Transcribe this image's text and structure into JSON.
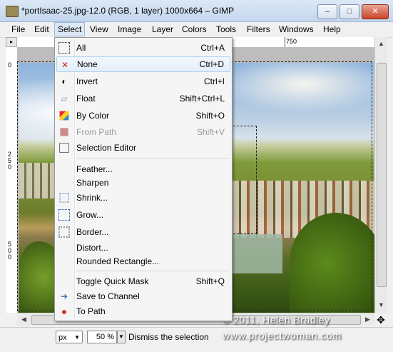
{
  "window": {
    "title": "*portIsaac-25.jpg-12.0 (RGB, 1 layer) 1000x664 – GIMP",
    "minimize": "–",
    "maximize": "□",
    "close": "✕"
  },
  "menubar": {
    "items": [
      "File",
      "Edit",
      "Select",
      "View",
      "Image",
      "Layer",
      "Colors",
      "Tools",
      "Filters",
      "Windows",
      "Help"
    ],
    "active": "Select"
  },
  "rulers": {
    "top_tick": "750",
    "left_ticks": [
      "0",
      "250",
      "500"
    ],
    "corner_icon": "▸"
  },
  "select_menu": {
    "items": [
      {
        "label": "All",
        "shortcut": "Ctrl+A",
        "icon": "select-all-icon",
        "enabled": true
      },
      {
        "label": "None",
        "shortcut": "Ctrl+D",
        "icon": "select-none-icon",
        "enabled": true,
        "highlighted": true
      },
      {
        "label": "Invert",
        "shortcut": "Ctrl+I",
        "icon": "invert-icon",
        "enabled": true
      },
      {
        "label": "Float",
        "shortcut": "Shift+Ctrl+L",
        "icon": "float-icon",
        "enabled": true
      },
      {
        "label": "By Color",
        "shortcut": "Shift+O",
        "icon": "by-color-icon",
        "enabled": true
      },
      {
        "label": "From Path",
        "shortcut": "Shift+V",
        "icon": "from-path-icon",
        "enabled": false
      },
      {
        "label": "Selection Editor",
        "shortcut": "",
        "icon": "selection-editor-icon",
        "enabled": true
      },
      {
        "label": "Feather...",
        "shortcut": "",
        "icon": "",
        "enabled": true
      },
      {
        "label": "Sharpen",
        "shortcut": "",
        "icon": "",
        "enabled": true
      },
      {
        "label": "Shrink...",
        "shortcut": "",
        "icon": "shrink-icon",
        "enabled": true
      },
      {
        "label": "Grow...",
        "shortcut": "",
        "icon": "grow-icon",
        "enabled": true
      },
      {
        "label": "Border...",
        "shortcut": "",
        "icon": "border-icon",
        "enabled": true
      },
      {
        "label": "Distort...",
        "shortcut": "",
        "icon": "",
        "enabled": true
      },
      {
        "label": "Rounded Rectangle...",
        "shortcut": "",
        "icon": "",
        "enabled": true
      },
      {
        "label": "Toggle Quick Mask",
        "shortcut": "Shift+Q",
        "icon": "",
        "enabled": true
      },
      {
        "label": "Save to Channel",
        "shortcut": "",
        "icon": "save-channel-icon",
        "enabled": true
      },
      {
        "label": "To Path",
        "shortcut": "",
        "icon": "to-path-icon",
        "enabled": true
      }
    ]
  },
  "statusbar": {
    "unit": "px",
    "zoom": "50 %",
    "message": "Dismiss the selection"
  },
  "watermark": {
    "line1": "© 2011, Helen Bradley",
    "line2": "www.projectwoman.com"
  },
  "colors": {
    "menu_highlight": "#e3eefa",
    "disabled_text": "#9a9a9a",
    "none_icon": "#d21d1d"
  }
}
